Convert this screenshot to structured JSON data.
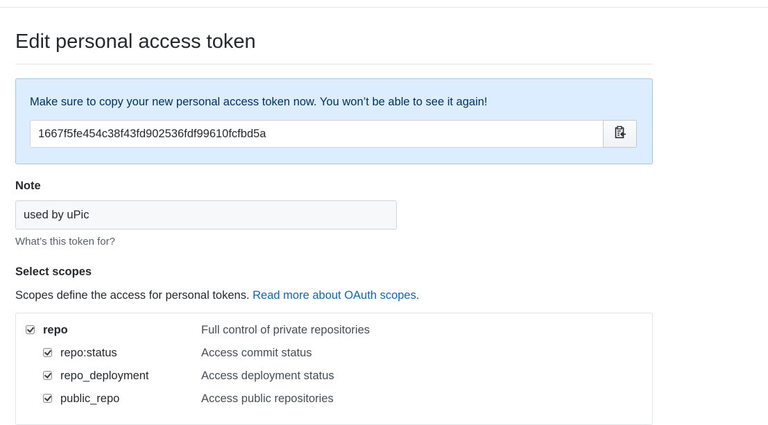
{
  "page": {
    "title": "Edit personal access token"
  },
  "flash": {
    "message": "Make sure to copy your new personal access token now. You won’t be able to see it again!",
    "token": "1667f5fe454c38f43fd902536fdf99610fcfbd5a",
    "copy_icon": "clipboard-icon"
  },
  "note": {
    "label": "Note",
    "value": "used by uPic",
    "hint": "What’s this token for?"
  },
  "scopes": {
    "heading": "Select scopes",
    "description": "Scopes define the access for personal tokens.",
    "link_text": "Read more about OAuth scopes.",
    "items": [
      {
        "name": "repo",
        "description": "Full control of private repositories",
        "checked": true
      },
      {
        "name": "repo:status",
        "description": "Access commit status",
        "checked": true
      },
      {
        "name": "repo_deployment",
        "description": "Access deployment status",
        "checked": true
      },
      {
        "name": "public_repo",
        "description": "Access public repositories",
        "checked": true
      }
    ]
  }
}
